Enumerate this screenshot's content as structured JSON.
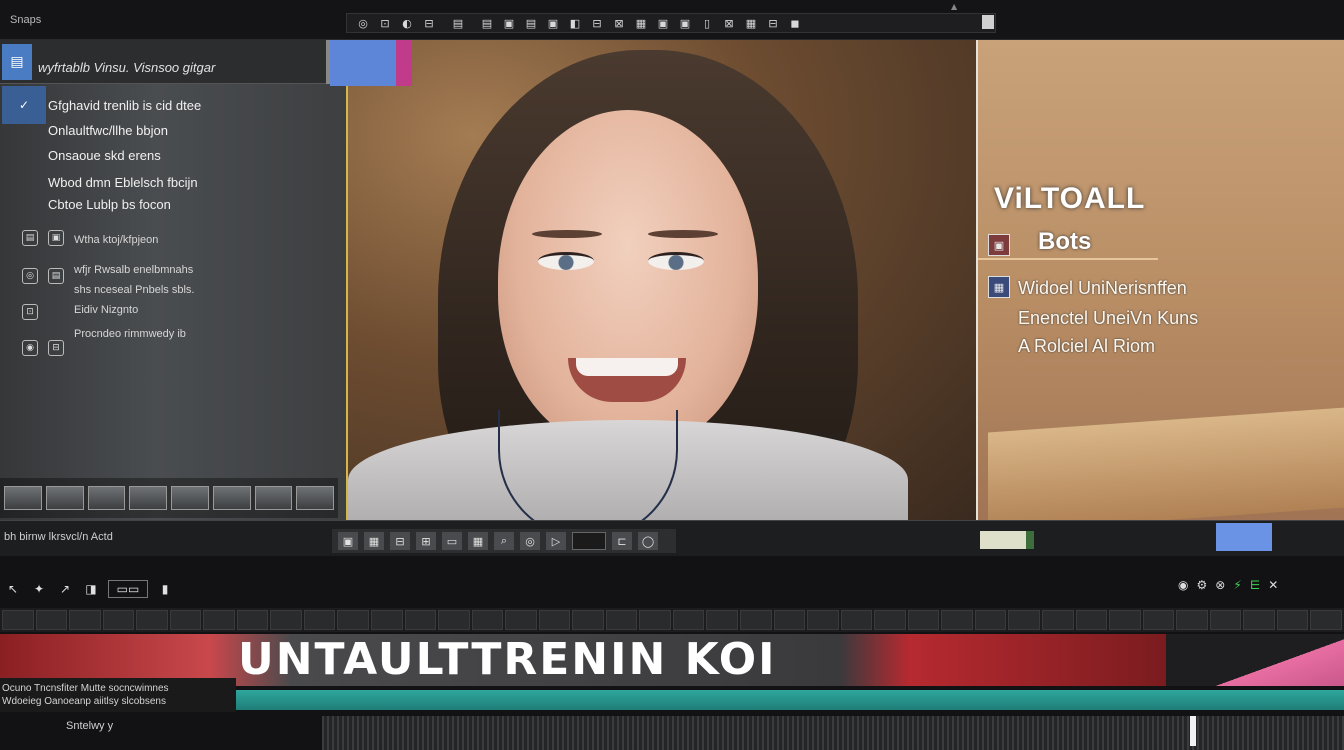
{
  "app": {
    "title": "Snaps"
  },
  "toolbar": {
    "buttons": [
      "◎",
      "⊡",
      "◐",
      "⊟",
      "▤",
      "▤",
      "▣",
      "▤",
      "▣",
      "◧",
      "⊟",
      "⊠",
      "▦",
      "▣",
      "▣",
      "▯",
      "⊠",
      "▦",
      "⊟",
      "◼"
    ],
    "end_label": "▮"
  },
  "left_panel": {
    "header_icon": "▤",
    "header_title": "wyfrtablb Vinsu. Visnsoo gitgar",
    "check_mark": "✓",
    "lines": [
      "Gfghavid trenlib is cid dtee",
      "Onlaultfwc/llhe bbjon",
      "Onsaoue skd erens",
      "Wbod dmn Eblelsch fbcijn",
      "Cbtoe Lublp bs focon"
    ],
    "small_items": [
      "Wtha ktoj/kfpjeon",
      "wfjr Rwsalb enelbmnahs",
      "shs nceseal Pnbels sbls.",
      "Eidiv Nizgnto",
      "Procndeo rimmwedy ib"
    ],
    "status": "bh birnw lkrsvcl/n Actd"
  },
  "preview": {
    "tag": ""
  },
  "right_panel": {
    "title": "ViLTOALL",
    "subtitle": "Bots",
    "lines": [
      "Widoel UniNerisnffen",
      "Enenctel UneiVn Kuns",
      "A Rolciel Al Riom"
    ]
  },
  "transport": {
    "buttons": [
      "▣",
      "▦",
      "⊟",
      "⊞",
      "▭",
      "▦",
      "⌕",
      "◎",
      "▷",
      "⊏",
      "◯"
    ]
  },
  "timeline": {
    "toolbar": [
      "↖",
      "✦",
      "↗",
      "◨",
      "▭▭",
      "▮"
    ],
    "right_icons": [
      "◉",
      "⚙",
      "⊗",
      "⚡",
      "⋿",
      "✕"
    ],
    "ruler_cells": [
      "",
      "",
      "",
      "",
      "",
      "",
      "",
      "",
      "",
      "",
      "",
      "",
      "",
      "",
      "",
      "",
      "",
      "",
      "",
      "",
      "",
      "",
      "",
      "",
      "",
      "",
      "",
      "",
      "",
      "",
      "",
      "",
      "",
      "",
      "",
      "",
      "",
      "",
      "",
      ""
    ],
    "clip_title": "UNTAULTTRENIN KOI",
    "track_info": [
      "Ocuno Tncnsfiter Mutte socncwimnes",
      "Wdoeieg Oanoeanp aiitlsy slcobsens"
    ],
    "track_name": "Sntelwy y",
    "colors": {
      "red": "#c9484c",
      "teal": "#2ea79c",
      "pink": "#e86ea2"
    }
  }
}
